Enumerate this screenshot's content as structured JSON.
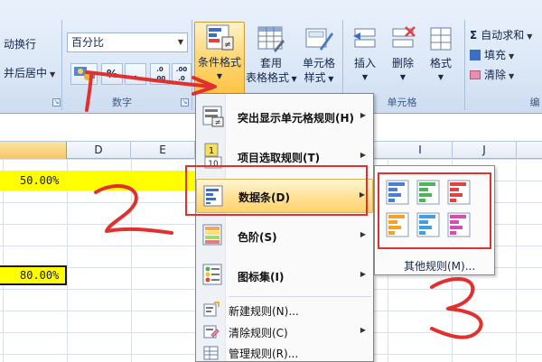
{
  "ribbon": {
    "alignment": {
      "wrap_text": "动换行",
      "merge_center": "并后居中"
    },
    "number": {
      "format_value": "百分比",
      "percent_symbol": "%",
      "comma_symbol": ",",
      "inc_decimal": ".0 .00",
      "dec_decimal": ".00 .0",
      "group_label": "数字"
    },
    "styles": {
      "conditional_format": "条件格式",
      "table_format_line1": "套用",
      "table_format_line2": "表格格式",
      "cell_style_line1": "单元格",
      "cell_style_line2": "样式"
    },
    "cells": {
      "insert": "插入",
      "delete": "删除",
      "format": "格式",
      "group_label": "单元格"
    },
    "editing": {
      "autosum": "自动求和",
      "fill": "填充",
      "clear": "清除",
      "partial_label": "编"
    }
  },
  "columns": [
    "D",
    "E",
    "I",
    "J"
  ],
  "cells": {
    "value1": "50.00%",
    "value2": "80.00%"
  },
  "menu": {
    "items": [
      {
        "label": "突出显示单元格规则(H)",
        "icon": "highlight-rules-icon",
        "submenu": true
      },
      {
        "label": "项目选取规则(T)",
        "icon": "top-bottom-rules-icon",
        "submenu": true
      },
      {
        "label": "数据条(D)",
        "icon": "data-bars-icon",
        "submenu": true,
        "highlighted": true
      },
      {
        "label": "色阶(S)",
        "icon": "color-scales-icon",
        "submenu": true
      },
      {
        "label": "图标集(I)",
        "icon": "icon-sets-icon",
        "submenu": true
      }
    ],
    "small_items": [
      {
        "label": "新建规则(N)...",
        "icon": "new-rule-icon",
        "submenu": false
      },
      {
        "label": "清除规则(C)",
        "icon": "clear-rules-icon",
        "submenu": true
      },
      {
        "label": "管理规则(R)...",
        "icon": "manage-rules-icon",
        "submenu": false
      }
    ]
  },
  "submenu": {
    "swatch_colors": [
      "#4a7fd1",
      "#4fb35a",
      "#e04141",
      "#f2a227",
      "#3fa0e0",
      "#d84bb0"
    ],
    "more_rules": "其他规则(M)..."
  },
  "annotations": {
    "marker_color": "#e0312f",
    "numbers": [
      "1",
      "2",
      "3"
    ]
  }
}
